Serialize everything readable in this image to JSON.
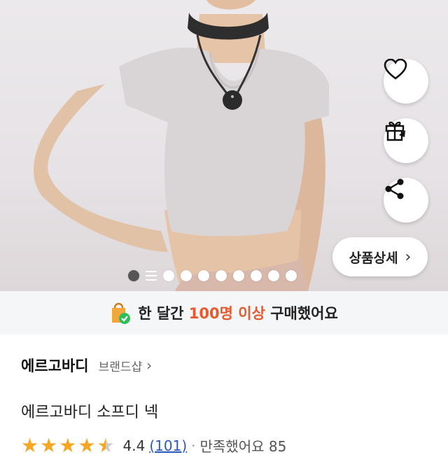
{
  "hero": {
    "image_desc": "product-photo",
    "carousel_count": 10,
    "carousel_active": 1
  },
  "actions": {
    "like_icon": "heart-icon",
    "gift_icon": "gift-icon",
    "share_icon": "share-icon"
  },
  "detail_button": {
    "label": "상품상세",
    "chevron": "›"
  },
  "purchase_banner": {
    "prefix": "한 달간 ",
    "highlight": "100명 이상",
    "suffix": " 구매했어요",
    "icon": "shopping-bag-check-icon"
  },
  "brand": {
    "name": "에르고바디",
    "shop_label": "브랜드샵",
    "chevron": "›"
  },
  "product": {
    "title": "에르고바디 소프디 넥"
  },
  "rating": {
    "value": "4.4",
    "count": "(101)",
    "separator": "·",
    "note": "만족했어요 85"
  },
  "colors": {
    "accent": "#e65a2e",
    "star": "#f5a623",
    "link": "#2b59c3"
  }
}
